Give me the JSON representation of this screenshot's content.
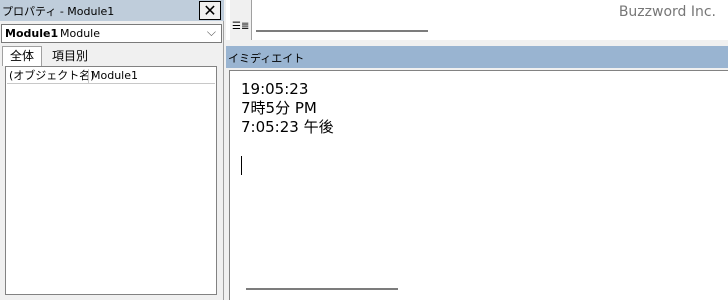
{
  "properties": {
    "title": "プロパティ - Module1",
    "close_glyph": "✕",
    "object_name": "Module1",
    "object_type": "Module",
    "chevron": "⌵",
    "tabs": [
      {
        "label": "全体"
      },
      {
        "label": "項目別"
      }
    ],
    "rows": [
      {
        "name": "(オブジェクト名)",
        "value": "Module1"
      }
    ]
  },
  "code_window": {
    "procedure_view_glyph": "☰",
    "module_view_glyph": "≣"
  },
  "watermark": "Buzzword Inc.",
  "immediate": {
    "title": "イミディエイト",
    "lines": [
      "19:05:23",
      "7時5分 PM",
      "7:05:23 午後"
    ]
  },
  "colors": {
    "titlebar_inactive": "#bfcddb",
    "titlebar_active": "#99b4d1",
    "scroll_thumb": "#7c7c7c"
  }
}
